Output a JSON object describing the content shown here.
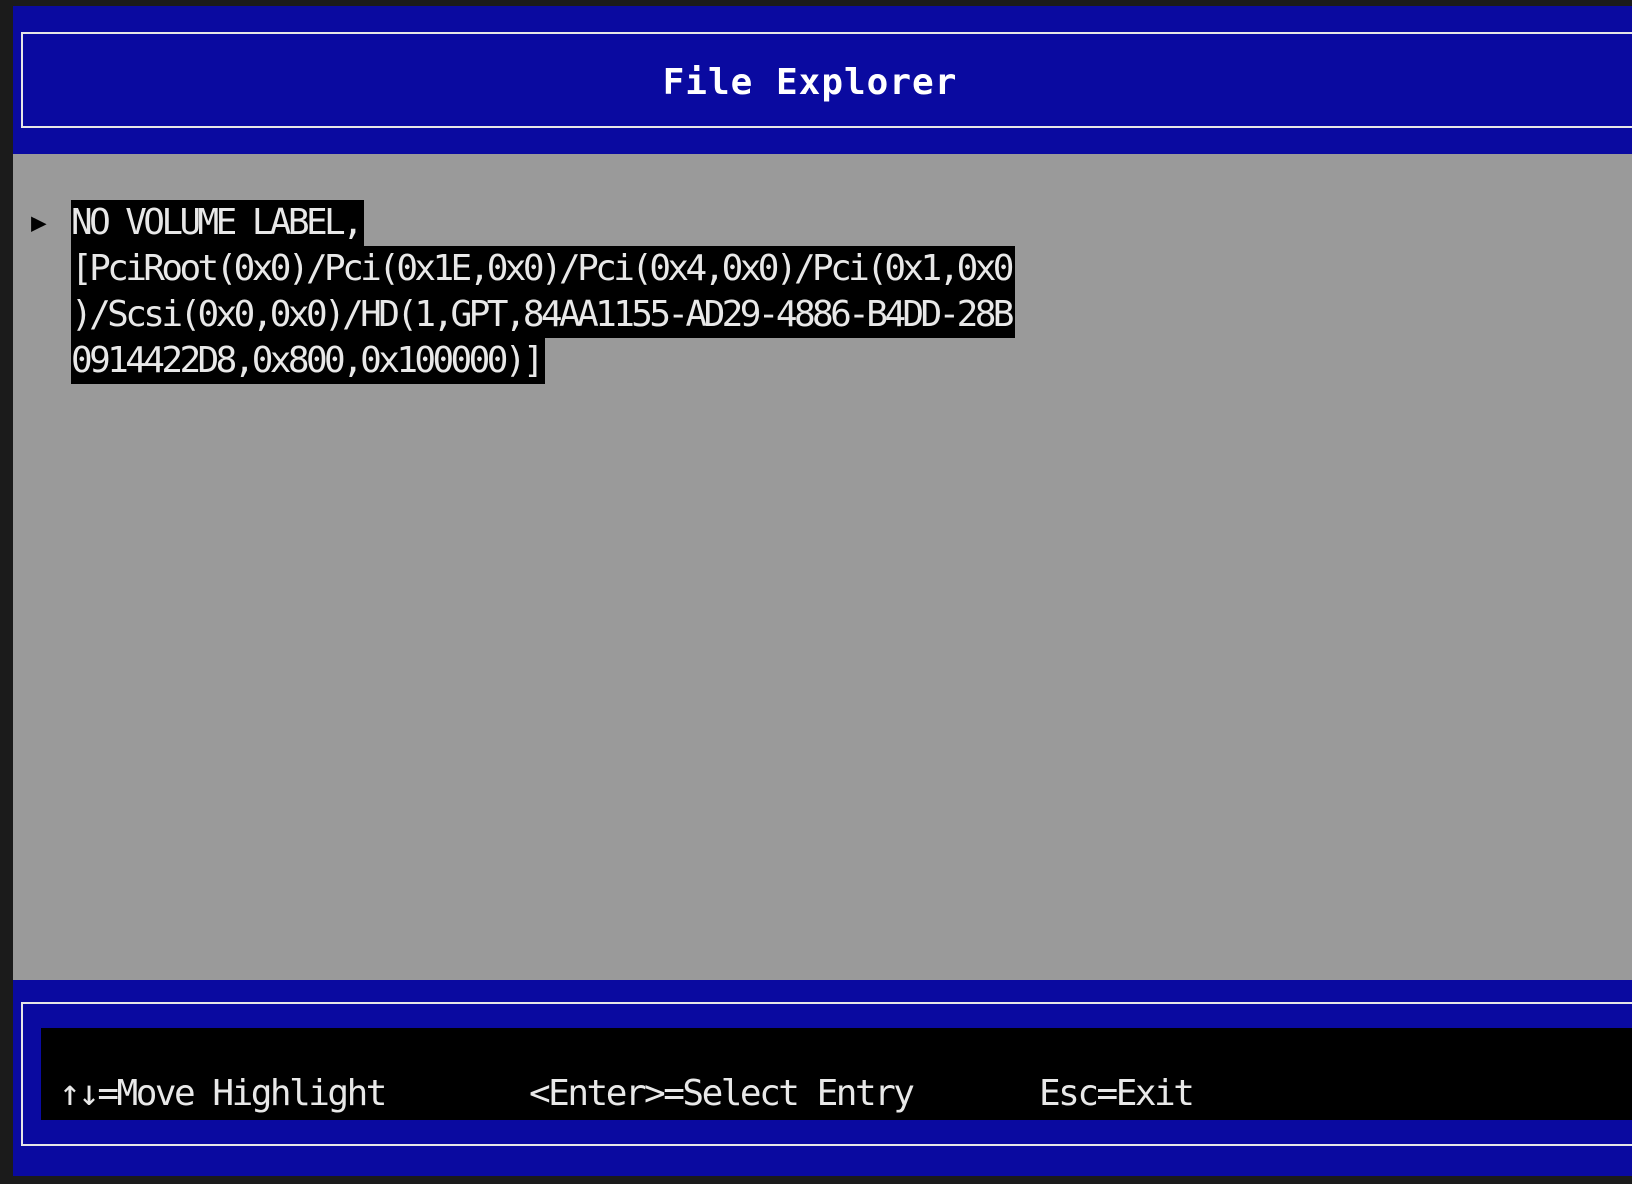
{
  "header": {
    "title": "File Explorer"
  },
  "entries": [
    {
      "marker": "▶",
      "lines": [
        "NO VOLUME LABEL,",
        "[PciRoot(0x0)/Pci(0x1E,0x0)/Pci(0x4,0x0)/Pci(0x1,0x0",
        ")/Scsi(0x0,0x0)/HD(1,GPT,84AA1155-AD29-4886-B4DD-28B",
        "0914422D8,0x800,0x100000)]"
      ]
    }
  ],
  "help": {
    "move": "↑↓=Move Highlight",
    "select": "<Enter>=Select Entry",
    "exit": "Esc=Exit"
  },
  "colors": {
    "bar_blue": "#0a0aa0",
    "content_gray": "#9a9a9a",
    "highlight_bg": "#000000",
    "text_light": "#e8e8e8"
  }
}
